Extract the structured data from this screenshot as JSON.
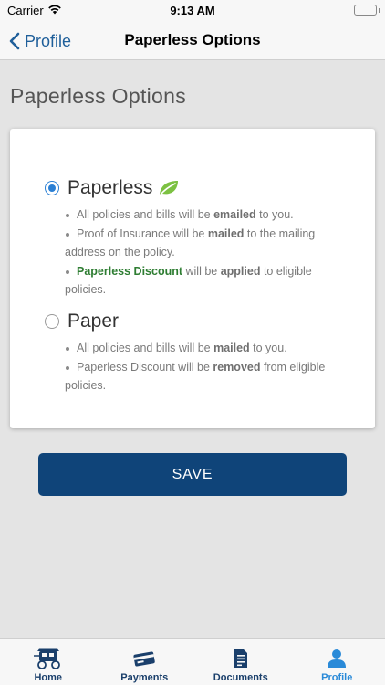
{
  "status_bar": {
    "carrier": "Carrier",
    "time": "9:13 AM"
  },
  "nav": {
    "back_label": "Profile",
    "title": "Paperless Options"
  },
  "page": {
    "heading": "Paperless Options"
  },
  "options": {
    "paperless": {
      "label": "Paperless",
      "selected": true,
      "icon": "leaf-icon",
      "bullet1": {
        "a": "All policies and bills will be ",
        "b": "emailed",
        "c": " to you."
      },
      "bullet2": {
        "a": "Proof of Insurance will be ",
        "b": "mailed",
        "c": " to the mailing address on the policy."
      },
      "bullet3": {
        "a": "Paperless Discount",
        "b": " will be ",
        "c": "applied",
        "d": " to eligible policies."
      }
    },
    "paper": {
      "label": "Paper",
      "selected": false,
      "bullet1": {
        "a": "All policies and bills will be ",
        "b": "mailed",
        "c": " to you."
      },
      "bullet2": {
        "a": "Paperless Discount will be ",
        "b": "removed",
        "c": " from eligible policies."
      }
    }
  },
  "save_button": {
    "label": "SAVE"
  },
  "tabs": [
    {
      "label": "Home",
      "icon": "stagecoach-icon",
      "active": false
    },
    {
      "label": "Payments",
      "icon": "credit-card-icon",
      "active": false
    },
    {
      "label": "Documents",
      "icon": "document-icon",
      "active": false
    },
    {
      "label": "Profile",
      "icon": "person-icon",
      "active": true
    }
  ],
  "colors": {
    "accent": "#2a7fd4",
    "brand_navy": "#0f4479",
    "discount_green": "#2e7d32",
    "leaf_green": "#7cc142"
  }
}
